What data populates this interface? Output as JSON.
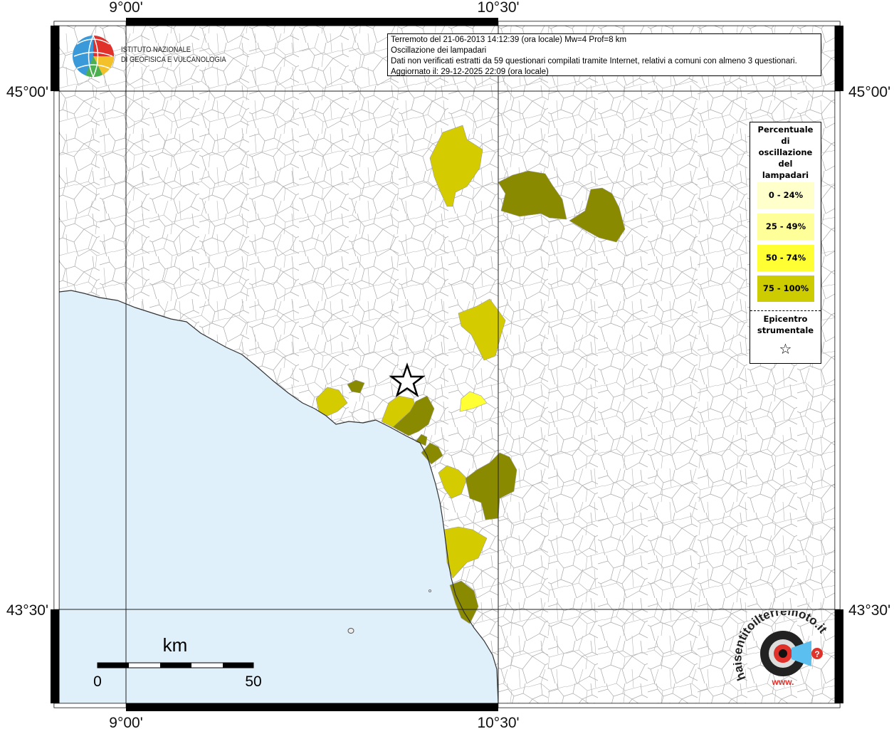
{
  "header": {
    "event_line": "Terremoto del 21-06-2013 14:12:39 (ora locale) Mw=4 Prof=8 km",
    "subject_line": "Oscillazione dei lampadari",
    "data_line": "Dati non verificati estratti da 59 questionari compilati tramite Internet, relativi a comuni con almeno 3 questionari.",
    "updated_line": "Aggiornato il: 29-12-2025 22:09 (ora locale)"
  },
  "institute": {
    "line1": "ISTITUTO NAZIONALE",
    "line2": "DI GEOFISICA E VULCANOLOGIA"
  },
  "axes": {
    "lon_left": "9°00'",
    "lon_right": "10°30'",
    "lat_top": "45°00'",
    "lat_bottom": "43°30'"
  },
  "legend": {
    "title_lines": [
      "Percentuale",
      "di",
      "oscillazione",
      "del",
      "lampadari"
    ],
    "classes": [
      {
        "label": "0 - 24%",
        "color": "#ffffcc"
      },
      {
        "label": "25 - 49%",
        "color": "#ffff99"
      },
      {
        "label": "50 - 74%",
        "color": "#ffff33"
      },
      {
        "label": "75 - 100%",
        "color": "#cccc00"
      }
    ],
    "epicenter_lines": [
      "Epicentro",
      "strumentale"
    ],
    "epicenter_symbol": "☆"
  },
  "scalebar": {
    "unit": "km",
    "min": "0",
    "max": "50"
  },
  "colors": {
    "sea": "#dff0fa",
    "class_light": "#d4cc00",
    "class_mid": "#ffff33",
    "class_dark": "#8a8a00",
    "boundary": "#9a9a9a"
  },
  "logo": {
    "text": "haisentitoilterremoto.it",
    "url_text": "www."
  }
}
